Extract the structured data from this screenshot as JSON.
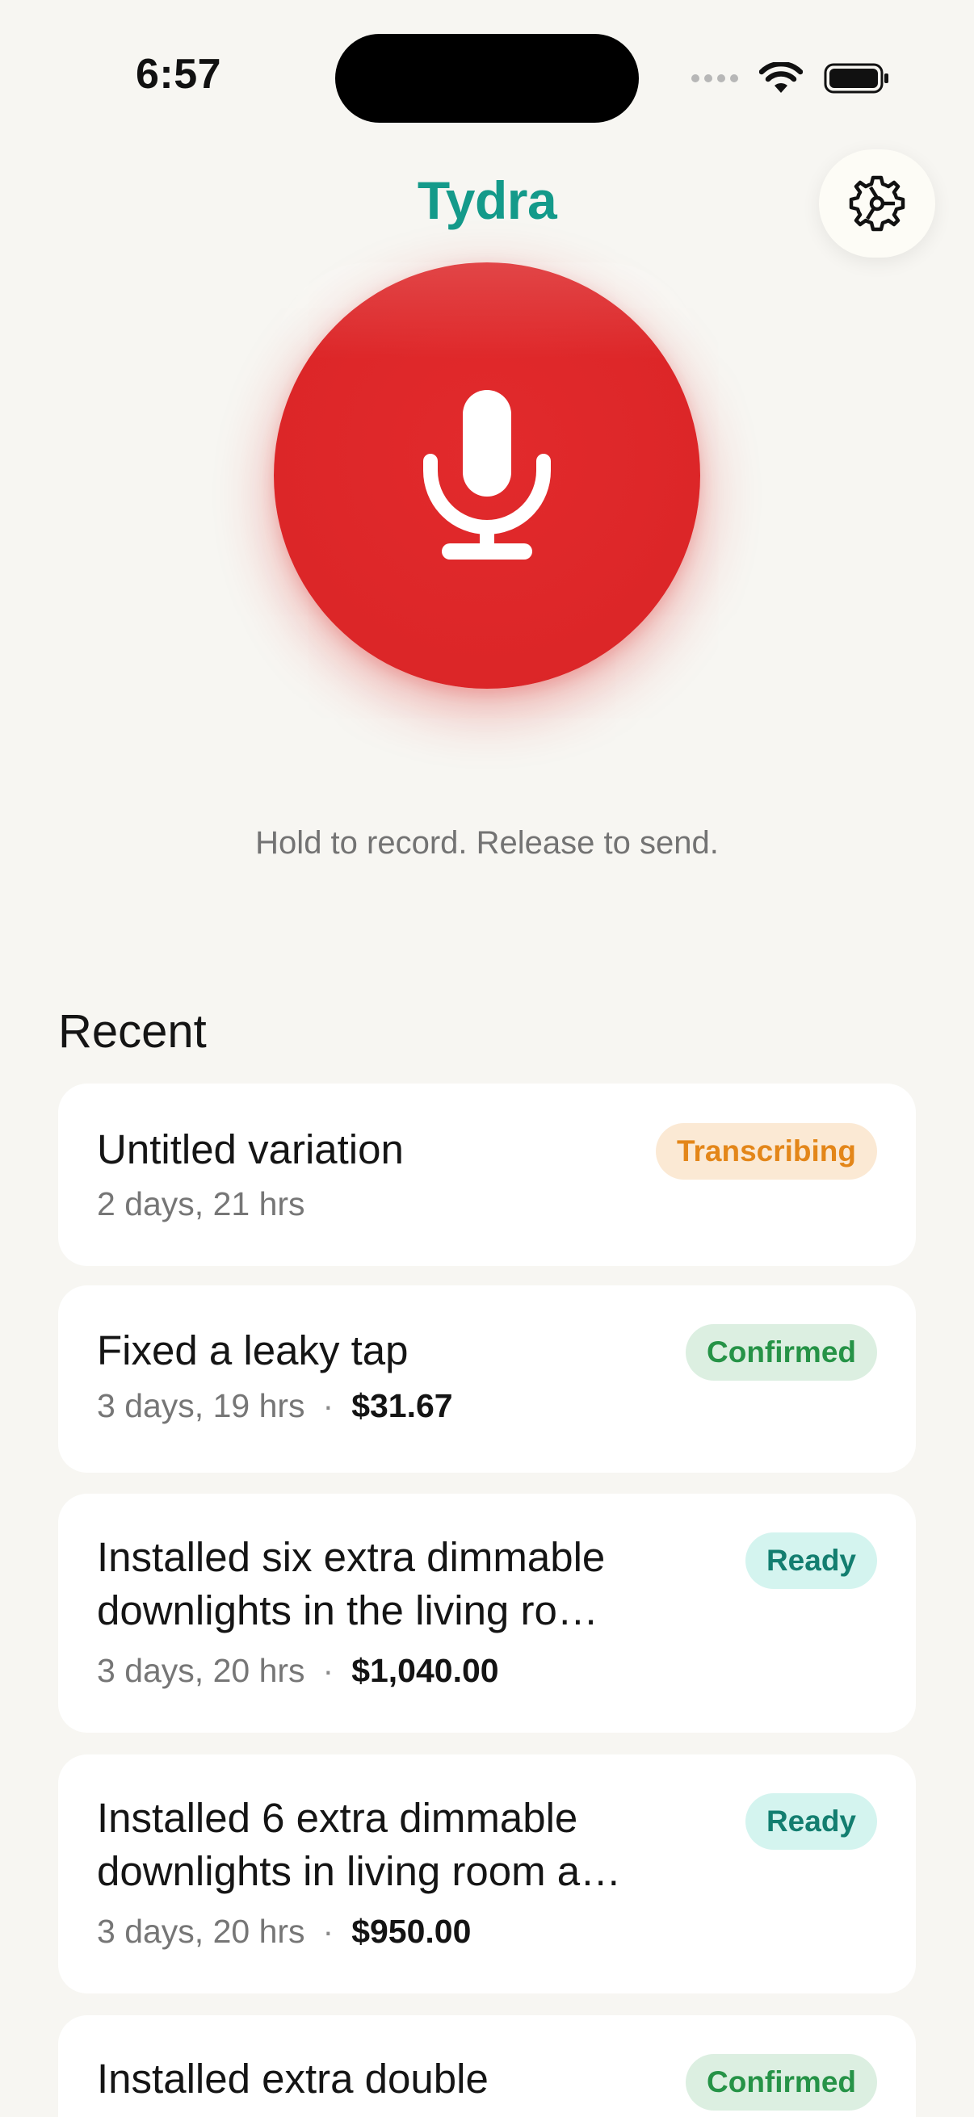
{
  "status_bar": {
    "time": "6:57"
  },
  "header": {
    "title": "Tydra"
  },
  "record": {
    "hint": "Hold to record. Release to send."
  },
  "recent": {
    "heading": "Recent",
    "items": [
      {
        "title_lines": [
          "Untitled variation"
        ],
        "time": "2 days, 21 hrs",
        "amount": "",
        "status": "Transcribing"
      },
      {
        "title_lines": [
          "Fixed a leaky tap"
        ],
        "time": "3 days, 19 hrs",
        "separator": "·",
        "amount": "$31.67",
        "status": "Confirmed"
      },
      {
        "title_lines": [
          "Installed six extra dimmable",
          "downlights in the living ro…"
        ],
        "time": "3 days, 20 hrs",
        "separator": "·",
        "amount": "$1,040.00",
        "status": "Ready"
      },
      {
        "title_lines": [
          "Installed 6 extra dimmable",
          "downlights in living room a…"
        ],
        "time": "3 days, 20 hrs",
        "separator": "·",
        "amount": "$950.00",
        "status": "Ready"
      },
      {
        "title_lines": [
          "Installed extra double"
        ],
        "status": "Confirmed"
      }
    ]
  },
  "colors": {
    "brand": "#149a8a",
    "record": "#dc2628",
    "background": "#f7f6f2",
    "transcribing": "#e38619",
    "confirmed": "#269347",
    "ready": "#137e70"
  },
  "icons": {
    "settings": "gear-icon",
    "record": "microphone-icon",
    "wifi": "wifi-icon",
    "battery": "battery-icon",
    "signal": "cellular-signal-icon"
  }
}
